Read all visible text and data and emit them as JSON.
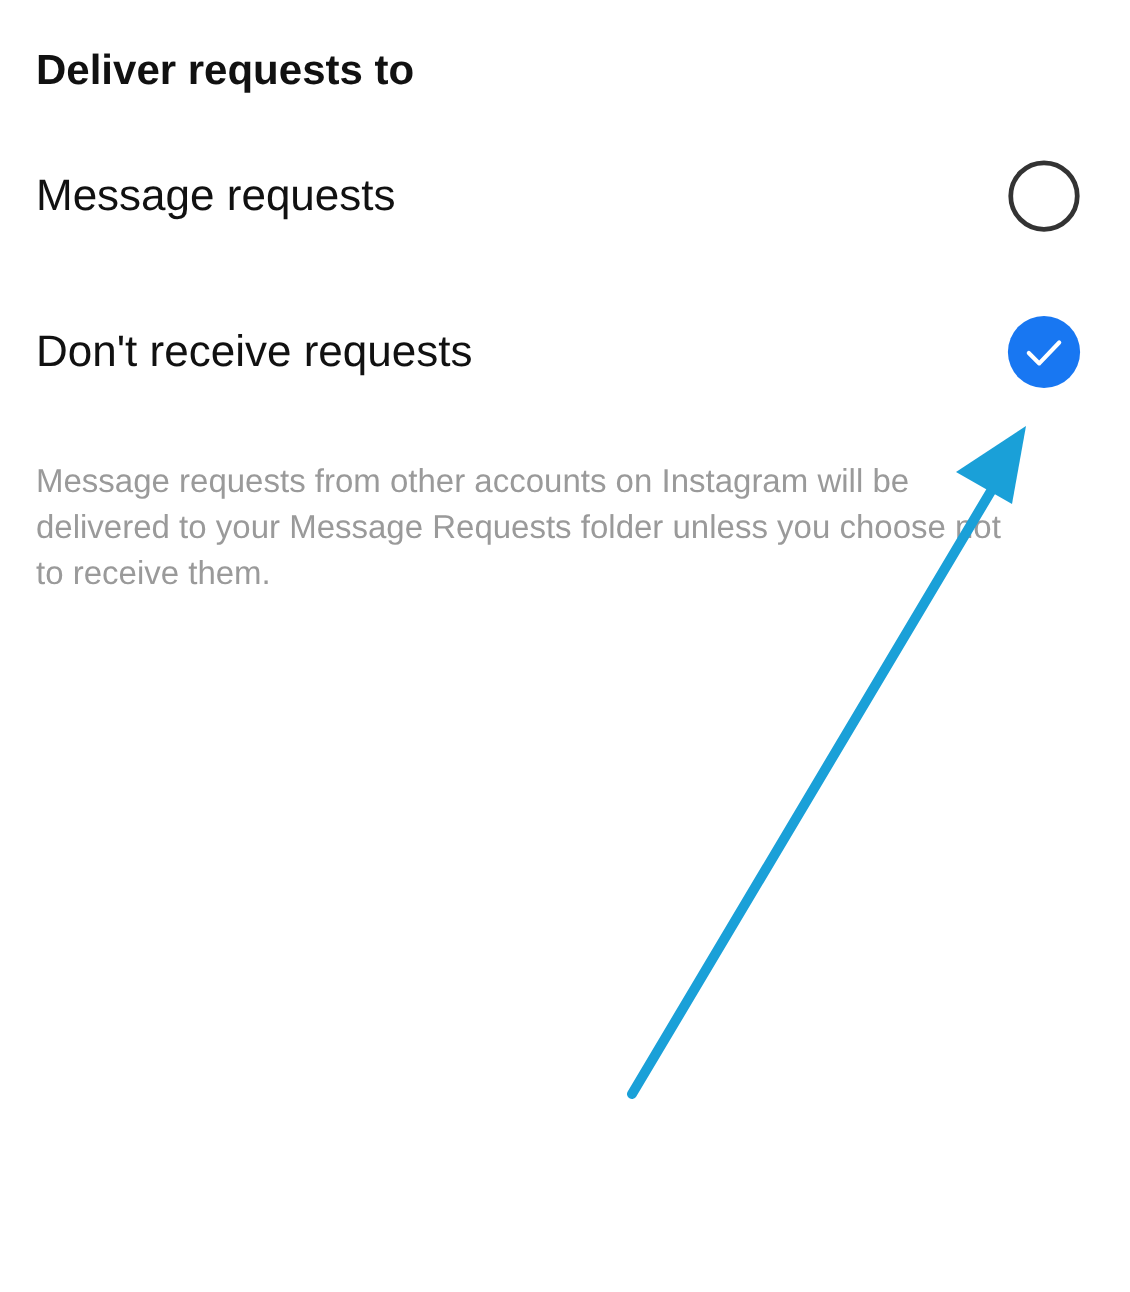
{
  "section_title": "Deliver requests to",
  "options": [
    {
      "label": "Message requests",
      "selected": false
    },
    {
      "label": "Don't receive requests",
      "selected": true
    }
  ],
  "description": "Message requests from other accounts on Instagram will be delivered to your Message Requests folder unless you choose not to receive them."
}
